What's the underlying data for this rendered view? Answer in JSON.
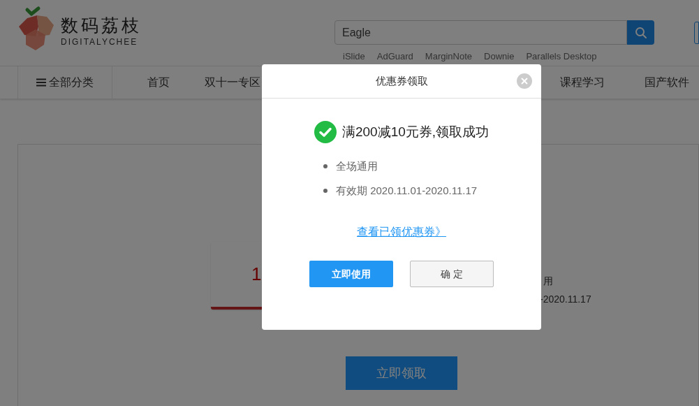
{
  "header": {
    "logo": {
      "name": "数码荔枝",
      "subtitle": "DIGITALYCHEE"
    },
    "search": {
      "value": "Eagle"
    },
    "hot_keywords": [
      "iSlide",
      "AdGuard",
      "MarginNote",
      "Downie",
      "Parallels Desktop"
    ]
  },
  "nav": {
    "all_categories": "全部分类",
    "items": [
      "首页",
      "双十一专区"
    ],
    "more_items": [
      "课程学习",
      "国产软件"
    ]
  },
  "coupon": {
    "amount": "1",
    "usage": "用",
    "validity": "-2020.11.17"
  },
  "claim_button": "立即领取",
  "dialog": {
    "title": "优惠券领取",
    "message": "满200减10元券,领取成功",
    "details": [
      "全场通用",
      "有效期 2020.11.01-2020.11.17"
    ],
    "link": "查看已领优惠券》",
    "buttons": [
      {
        "label": "立即使用",
        "kind": "primary"
      },
      {
        "label": "确 定",
        "kind": "secondary"
      }
    ]
  }
}
